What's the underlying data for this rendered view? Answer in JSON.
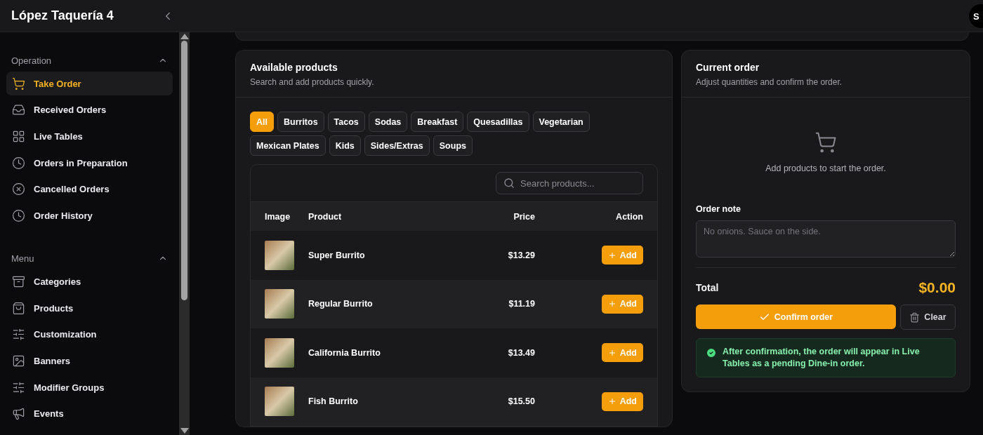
{
  "app": {
    "title": "López Taquería 4",
    "avatar": "S"
  },
  "sidebar": {
    "sections": [
      {
        "title": "Operation",
        "expanded": true,
        "items": [
          {
            "label": "Take Order",
            "selected": true
          },
          {
            "label": "Received Orders",
            "selected": false
          },
          {
            "label": "Live Tables",
            "selected": false
          },
          {
            "label": "Orders in Preparation",
            "selected": false
          },
          {
            "label": "Cancelled Orders",
            "selected": false
          },
          {
            "label": "Order History",
            "selected": false
          }
        ]
      },
      {
        "title": "Menu",
        "expanded": true,
        "items": [
          {
            "label": "Categories",
            "selected": false
          },
          {
            "label": "Products",
            "selected": false
          },
          {
            "label": "Customization",
            "selected": false
          },
          {
            "label": "Banners",
            "selected": false
          },
          {
            "label": "Modifier Groups",
            "selected": false
          },
          {
            "label": "Events",
            "selected": false
          }
        ]
      }
    ]
  },
  "products_panel": {
    "title": "Available products",
    "subtitle": "Search and add products quickly.",
    "filters": [
      {
        "label": "All",
        "selected": true
      },
      {
        "label": "Burritos",
        "selected": false
      },
      {
        "label": "Tacos",
        "selected": false
      },
      {
        "label": "Sodas",
        "selected": false
      },
      {
        "label": "Breakfast",
        "selected": false
      },
      {
        "label": "Quesadillas",
        "selected": false
      },
      {
        "label": "Vegetarian",
        "selected": false
      },
      {
        "label": "Mexican Plates",
        "selected": false
      },
      {
        "label": "Kids",
        "selected": false
      },
      {
        "label": "Sides/Extras",
        "selected": false
      },
      {
        "label": "Soups",
        "selected": false
      }
    ],
    "search": {
      "placeholder": "Search products..."
    },
    "table": {
      "columns": [
        "Image",
        "Product",
        "Price",
        "Action"
      ],
      "rows": [
        {
          "product": "Super Burrito",
          "price": "$13.29",
          "action": "Add"
        },
        {
          "product": "Regular Burrito",
          "price": "$11.19",
          "action": "Add"
        },
        {
          "product": "California Burrito",
          "price": "$13.49",
          "action": "Add"
        },
        {
          "product": "Fish Burrito",
          "price": "$15.50",
          "action": "Add"
        }
      ]
    }
  },
  "order_panel": {
    "title": "Current order",
    "subtitle": "Adjust quantities and confirm the order.",
    "empty_text": "Add products to start the order.",
    "note": {
      "label": "Order note",
      "placeholder": "No onions. Sauce on the side."
    },
    "total_label": "Total",
    "total": "$0.00",
    "confirm_button": "Confirm order",
    "clear_button": "Clear",
    "info": "After confirmation, the order will appear in Live Tables as a pending Dine-in order."
  }
}
